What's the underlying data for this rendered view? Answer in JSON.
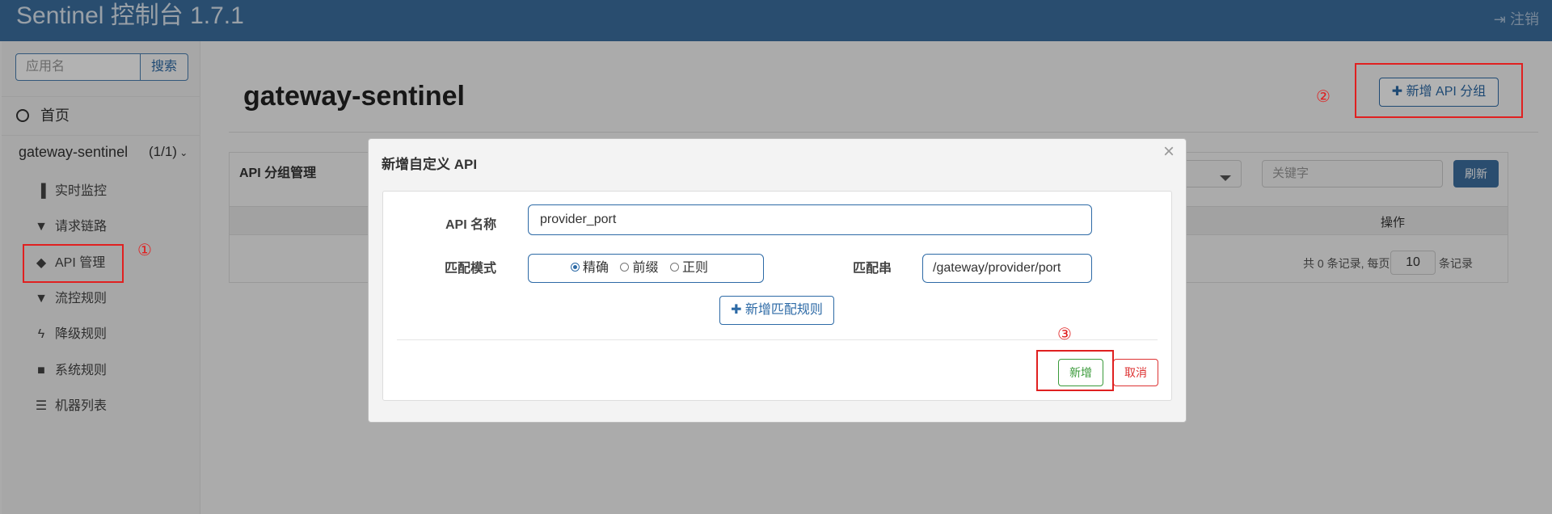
{
  "navbar": {
    "brand": "Sentinel 控制台 1.7.1",
    "logout_icon": "sign-out-icon",
    "logout": "注销"
  },
  "sidebar": {
    "search_placeholder": "应用名",
    "search_button": "搜索",
    "home": {
      "icon": "dashboard-icon",
      "label": "首页"
    },
    "app": {
      "name": "gateway-sentinel",
      "count": "(1/1)",
      "icon": "chevron-down-icon"
    },
    "items": [
      {
        "icon": "bar-chart-icon",
        "label": "实时监控"
      },
      {
        "icon": "filter-icon",
        "label": "请求链路"
      },
      {
        "icon": "tags-icon",
        "label": "API 管理"
      },
      {
        "icon": "filter-icon",
        "label": "流控规则"
      },
      {
        "icon": "bolt-icon",
        "label": "降级规则"
      },
      {
        "icon": "lock-icon",
        "label": "系统规则"
      },
      {
        "icon": "list-icon",
        "label": "机器列表"
      }
    ]
  },
  "main": {
    "title": "gateway-sentinel",
    "add_group_button": "新增 API 分组",
    "panel": {
      "title": "API 分组管理",
      "keyword_placeholder": "关键字",
      "refresh_button": "刷新",
      "column_op": "操作",
      "pager_total": "共 0 条记录, 每页",
      "pager_size": "10",
      "pager_suffix": "条记录"
    }
  },
  "modal": {
    "title": "新增自定义 API",
    "close": "×",
    "api_name_label": "API 名称",
    "api_name_value": "provider_port",
    "match_mode_label": "匹配模式",
    "match_modes": [
      "精确",
      "前缀",
      "正则"
    ],
    "match_mode_selected": "精确",
    "match_string_label": "匹配串",
    "match_string_value": "/gateway/provider/port",
    "add_rule_button": "新增匹配规则",
    "add_button": "新增",
    "cancel_button": "取消"
  },
  "annotations": {
    "one": "①",
    "two": "②",
    "three": "③",
    "color": "#e02020"
  }
}
